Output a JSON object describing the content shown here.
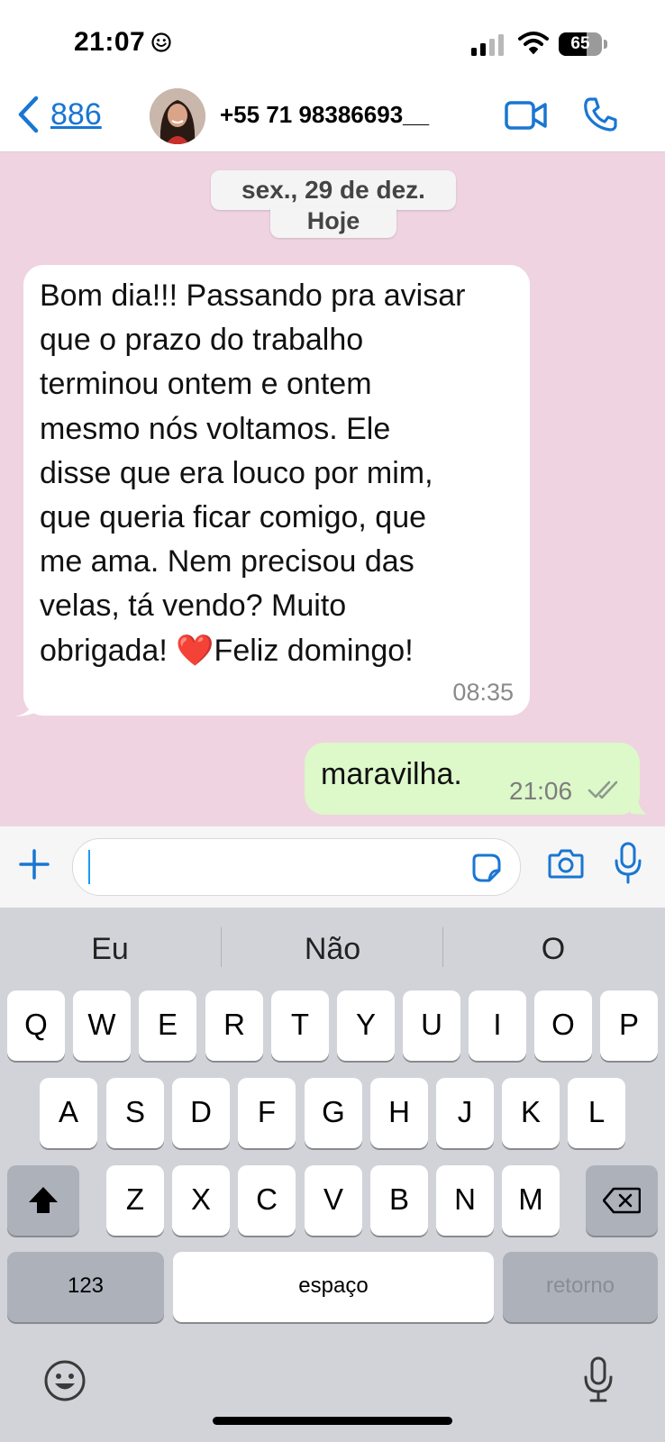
{
  "status_bar": {
    "time": "21:07",
    "battery_level": "65",
    "battery_fraction": 0.65,
    "icons": [
      "smiley-icon",
      "cellular-signal-icon",
      "wifi-icon",
      "battery-icon"
    ]
  },
  "header": {
    "back_count": "886",
    "contact_name": "+55 71 98386693__",
    "icons": [
      "chevron-left-icon",
      "video-call-icon",
      "phone-icon"
    ]
  },
  "chat": {
    "date_label": "sex., 29 de dez.",
    "today_label": "Hoje",
    "messages": [
      {
        "direction": "incoming",
        "text": "Bom dia!!! Passando pra avisar\nque o prazo do trabalho\nterminou ontem e ontem\nmesmo nós voltamos. Ele\ndisse que era louco por mim,\nque queria ficar comigo, que\nme ama. Nem precisou das\nvelas, tá vendo? Muito\nobrigada! ❤️Feliz domingo!",
        "time": "08:35"
      },
      {
        "direction": "outgoing",
        "text": "maravilha.",
        "time": "21:06",
        "status": "read-double-check"
      }
    ]
  },
  "composer": {
    "input_value": "",
    "icons": [
      "plus-icon",
      "sticker-icon",
      "camera-icon",
      "microphone-icon"
    ]
  },
  "keyboard": {
    "suggestions": [
      "Eu",
      "Não",
      "O"
    ],
    "rows": [
      [
        "Q",
        "W",
        "E",
        "R",
        "T",
        "Y",
        "U",
        "I",
        "O",
        "P"
      ],
      [
        "A",
        "S",
        "D",
        "F",
        "G",
        "H",
        "J",
        "K",
        "L"
      ],
      [
        "Z",
        "X",
        "C",
        "V",
        "B",
        "N",
        "M"
      ]
    ],
    "numbers_key": "123",
    "space_key": "espaço",
    "return_key": "retorno",
    "icons": [
      "shift-icon",
      "backspace-icon",
      "emoji-icon",
      "dictation-mic-icon"
    ]
  },
  "colors": {
    "chat_background": "#efd3e0",
    "outgoing_bubble": "#ddf8c9",
    "incoming_bubble": "#ffffff",
    "accent_blue": "#1976d2",
    "keyboard_background": "#d1d3d9"
  }
}
